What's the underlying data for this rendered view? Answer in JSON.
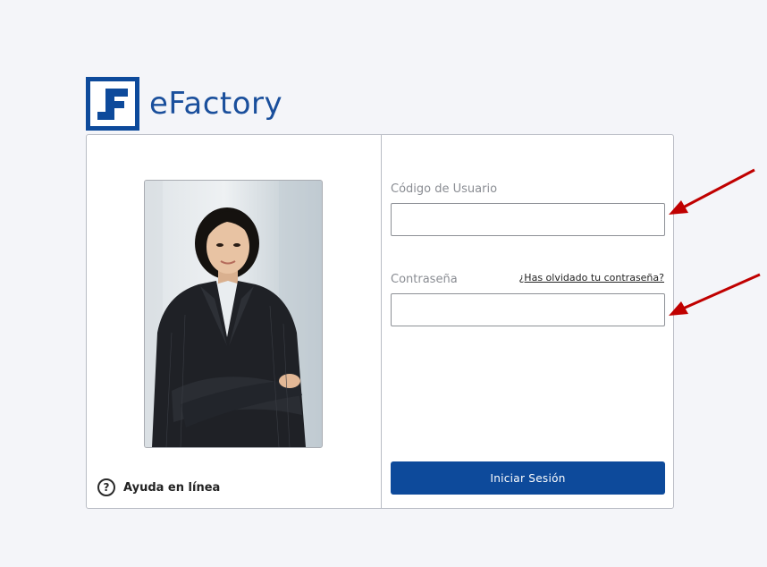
{
  "brand": {
    "name": "eFactory",
    "logo_icon": "efactory-logo-icon",
    "primary_color": "#0d4a9b"
  },
  "left_panel": {
    "photo_icon": "businesswoman-photo",
    "help": {
      "icon": "question-circle-icon",
      "label": "Ayuda en línea"
    }
  },
  "login_form": {
    "username": {
      "label": "Código de Usuario",
      "value": ""
    },
    "password": {
      "label": "Contraseña",
      "value": "",
      "forgot_link": "¿Has olvidado tu contraseña?"
    },
    "submit_label": "Iniciar Sesión"
  },
  "annotations": {
    "arrow_color": "#c00000"
  }
}
